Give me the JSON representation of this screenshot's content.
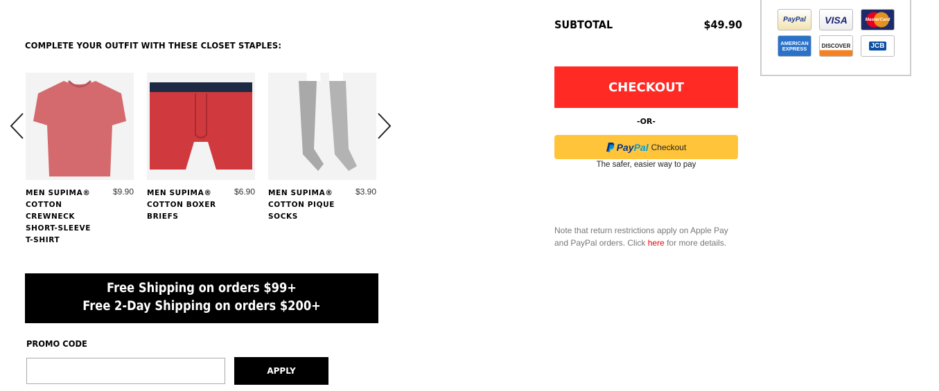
{
  "outfit": {
    "heading": "COMPLETE YOUR OUTFIT WITH THESE CLOSET STAPLES:",
    "prev_icon": "chevron-left-icon",
    "next_icon": "chevron-right-icon",
    "products": [
      {
        "name": "MEN SUPIMA® COTTON CREWNECK SHORT-SLEEVE T-SHIRT",
        "price": "$9.90",
        "image": "red-tshirt",
        "color": "#d46a6e"
      },
      {
        "name": "MEN SUPIMA® COTTON BOXER BRIEFS",
        "price": "$6.90",
        "image": "red-boxer-briefs",
        "color": "#d03a3f"
      },
      {
        "name": "MEN SUPIMA® COTTON PIQUE SOCKS",
        "price": "$3.90",
        "image": "gray-socks",
        "color": "#a9a9a9"
      }
    ]
  },
  "shipping_banner": {
    "line1": "Free Shipping on orders $99+",
    "line2": "Free 2-Day Shipping on orders $200+"
  },
  "promo": {
    "label": "PROMO CODE",
    "input_value": "",
    "input_placeholder": "",
    "apply_label": "APPLY"
  },
  "summary": {
    "subtotal_label": "SUBTOTAL",
    "subtotal_value": "$49.90",
    "checkout_label": "CHECKOUT",
    "or_label": "-OR-",
    "paypal_pay": "Pay",
    "paypal_pal": "Pal",
    "paypal_checkout": "Checkout",
    "paypal_tagline": "The safer, easier way to pay",
    "note_before": "Note that return restrictions apply on Apple Pay and PayPal orders. Click ",
    "note_link": "here",
    "note_after": " for more details."
  },
  "payment_methods": [
    {
      "name": "PayPal",
      "icon": "paypal-card-icon"
    },
    {
      "name": "VISA",
      "icon": "visa-card-icon"
    },
    {
      "name": "MasterCard",
      "icon": "mastercard-card-icon"
    },
    {
      "name": "AMERICAN EXPRESS",
      "icon": "amex-card-icon"
    },
    {
      "name": "DISCOVER",
      "icon": "discover-card-icon"
    },
    {
      "name": "JCB",
      "icon": "jcb-card-icon"
    }
  ],
  "colors": {
    "checkout": "#ff2a24",
    "paypal_button": "#ffc439",
    "banner": "#000000",
    "link": "#e00000"
  }
}
